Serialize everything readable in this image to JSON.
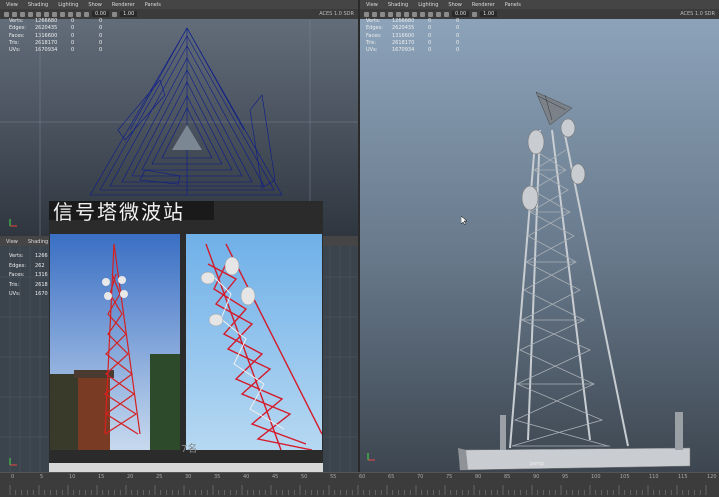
{
  "menus": [
    "View",
    "Shading",
    "Lighting",
    "Show",
    "Renderer",
    "Panels"
  ],
  "bottom_left_menus": [
    "View",
    "Shading"
  ],
  "toolbar": {
    "field1": "0.00",
    "field2": "1.00",
    "color_tag": "ACES 1.0 SDR"
  },
  "hud": {
    "labels": [
      "Verts:",
      "Edges:",
      "Faces:",
      "Tris:",
      "UVs:"
    ],
    "values": [
      "1266680",
      "2620435",
      "1316600",
      "2618170",
      "1670934"
    ],
    "sel": [
      "0",
      "0",
      "0",
      "0",
      "0"
    ],
    "extra": [
      "0",
      "0",
      "0",
      "0",
      "0"
    ]
  },
  "hud_small": {
    "labels": [
      "Verts:",
      "Edges:",
      "Faces:",
      "Tris:",
      "UVs:"
    ],
    "values": [
      "1266",
      "262",
      "1316",
      "2618",
      "1670"
    ]
  },
  "overlay_text": "信号塔微波站",
  "overlay_text_small": "7名",
  "persp_label": "persp",
  "timeline_ticks": [
    "0",
    "5",
    "10",
    "15",
    "20",
    "25",
    "30",
    "35",
    "40",
    "45",
    "50",
    "55",
    "60",
    "65",
    "70",
    "75",
    "80",
    "85",
    "90",
    "95",
    "100",
    "105",
    "110",
    "115",
    "120"
  ]
}
